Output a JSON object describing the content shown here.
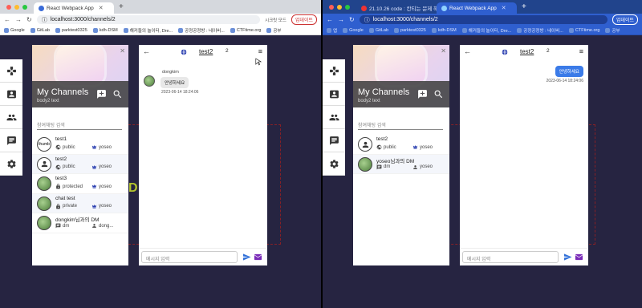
{
  "browser": {
    "left": {
      "tabs": [
        {
          "label": "React Webpack App",
          "active": true
        }
      ],
      "url": "localhost:3000/channels/2",
      "toolbar_right": "시크릿 모드",
      "profile": "업데이트",
      "bookmarks": [
        "Google",
        "GitLab",
        "parktest0325",
        "kdh-DSM",
        "해커들의 놀이터, Dre...",
        "공정공정방 : 네이버...",
        "CTFtime.org",
        "공부"
      ]
    },
    "right": {
      "tabs": [
        {
          "label": "21.10.26 code : 칸티는 문제 해결",
          "active": false
        },
        {
          "label": "React Webpack App",
          "active": true
        }
      ],
      "url": "localhost:3000/channels/2",
      "profile": "업데이트",
      "bookmarks": [
        "앱",
        "Google",
        "GitLab",
        "parktest0325",
        "kdh-DSM",
        "해커들의 놀이터, Dre...",
        "공정공정방 : 네이버...",
        "CTFtime.org",
        "공부"
      ]
    }
  },
  "colors": {
    "app_bg": "#262441",
    "accent": "#3b7be8",
    "crown": "#2a3fb0",
    "mail": "#7a2bb8"
  },
  "sidebar": {
    "icons": [
      "gamepad-icon",
      "contact-card-icon",
      "people-icon",
      "chat-icon",
      "gear-icon"
    ]
  },
  "channels_panel": {
    "title": "My Channels",
    "subtitle": "body2 text",
    "search_placeholder": "참여채팅 검색",
    "add_icon": "add-channel-icon",
    "search_icon": "channel-search-icon",
    "left_list": [
      {
        "name": "test1",
        "type": "public",
        "owner": "yoseo",
        "avatar": "thumb"
      },
      {
        "name": "test2",
        "type": "public",
        "owner": "yoseo",
        "avatar": "person"
      },
      {
        "name": "test3",
        "type": "protected",
        "owner": "yoseo",
        "avatar": "photo"
      },
      {
        "name": "chat test",
        "type": "private",
        "owner": "yoseo",
        "avatar": "photo"
      },
      {
        "name": "dongkim님과의 DM",
        "type": "dm",
        "owner": "dong...",
        "avatar": "photo"
      }
    ],
    "right_list": [
      {
        "name": "test2",
        "type": "public",
        "owner": "yoseo",
        "avatar": "person"
      },
      {
        "name": "yoseo님과의 DM",
        "type": "dm",
        "owner": "yoseo",
        "avatar": "photo"
      }
    ]
  },
  "chat": {
    "channel_name": "test2",
    "member_count": "2",
    "input_placeholder": "메시지 입력",
    "left_message": {
      "sender": "dongkim",
      "text": "안녕하세요",
      "time": "2023-06-14 18:24:06"
    },
    "right_message": {
      "text": "안녕하세요",
      "time": "2023-06-14 18:24:06"
    }
  }
}
